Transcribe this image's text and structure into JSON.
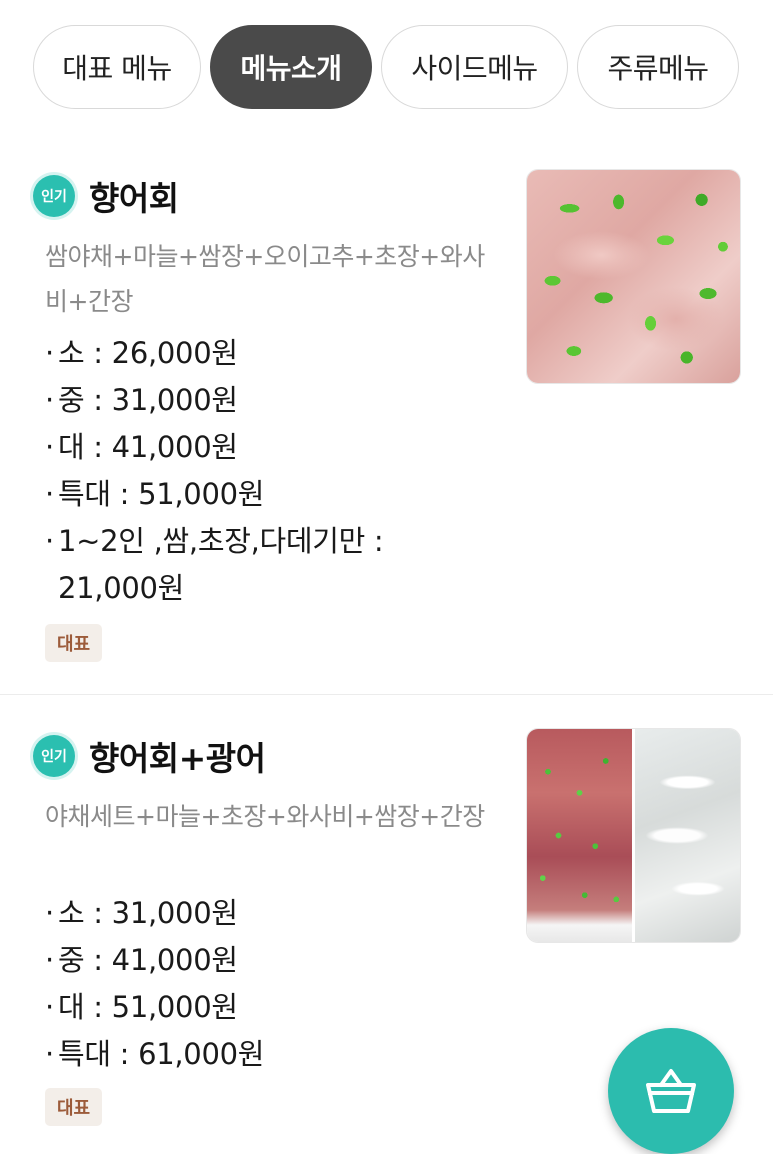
{
  "tabs": [
    {
      "label": "대표 메뉴",
      "active": false
    },
    {
      "label": "메뉴소개",
      "active": true
    },
    {
      "label": "사이드메뉴",
      "active": false
    },
    {
      "label": "주류메뉴",
      "active": false
    }
  ],
  "items": [
    {
      "badge": "인기",
      "title": "향어회",
      "description": "쌈야채+마늘+쌈장+오이고추+초장+와사비+간장",
      "prices": [
        "소 : 26,000원",
        "중 : 31,000원",
        "대 : 41,000원",
        "특대 : 51,000원",
        "1~2인 ,쌈,초장,다데기만 : 21,000원"
      ],
      "tag": "대표"
    },
    {
      "badge": "인기",
      "title": "향어회+광어",
      "description": "야채세트+마늘+초장+와사비+쌈장+간장",
      "prices": [
        "소 : 31,000원",
        "중 : 41,000원",
        "대 : 51,000원",
        "특대 : 61,000원"
      ],
      "tag": "대표"
    }
  ],
  "cart": {
    "icon": "basket-icon"
  },
  "colors": {
    "accent": "#2cbcae",
    "active_tab": "#4a4a4a",
    "tag_text": "#9c5b3a",
    "tag_bg": "#f3eee9"
  }
}
